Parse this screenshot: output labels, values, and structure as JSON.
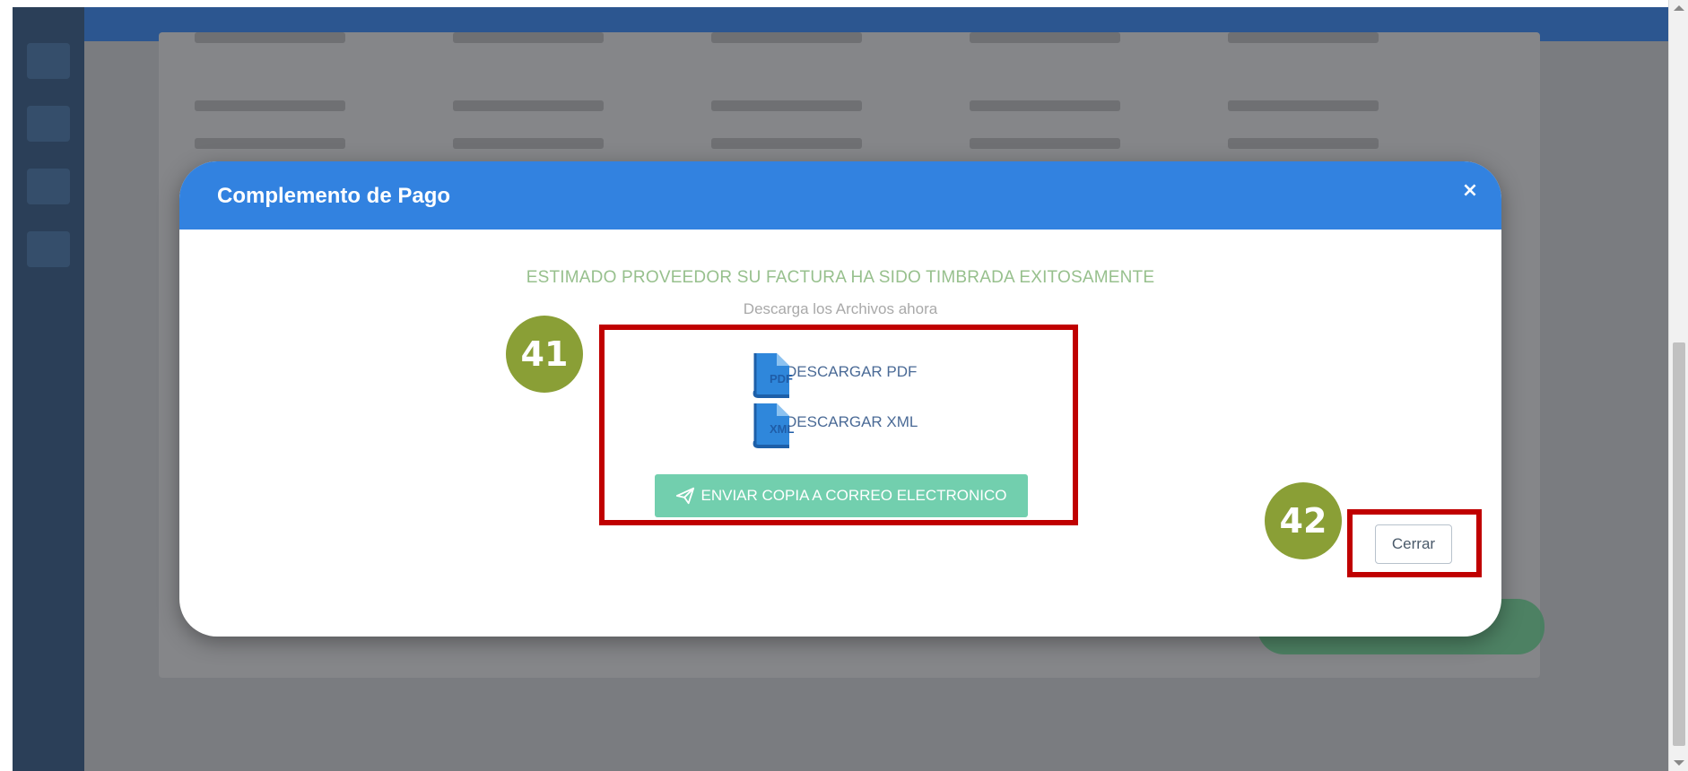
{
  "modal": {
    "title": "Complemento de Pago",
    "close_symbol": "×",
    "success_message": "ESTIMADO PROVEEDOR SU FACTURA HA SIDO TIMBRADA EXITOSAMENTE",
    "download_subtitle": "Descarga los Archivos ahora",
    "downloads": [
      {
        "icon": "pdf-file-icon",
        "ext": "PDF",
        "label": "DESCARGAR PDF"
      },
      {
        "icon": "xml-file-icon",
        "ext": "XML",
        "label": "DESCARGAR XML"
      }
    ],
    "email_button": {
      "icon": "paper-plane-icon",
      "label": "ENVIAR COPIA A CORREO ELECTRONICO"
    },
    "close_button": "Cerrar"
  },
  "annotations": [
    {
      "number": "41",
      "target": "download-options"
    },
    {
      "number": "42",
      "target": "close-button"
    }
  ],
  "colors": {
    "header": "#3282e0",
    "success_text": "#97c08d",
    "email_button": "#72cfae",
    "highlight": "#c00000",
    "badge": "#8a9f36"
  }
}
